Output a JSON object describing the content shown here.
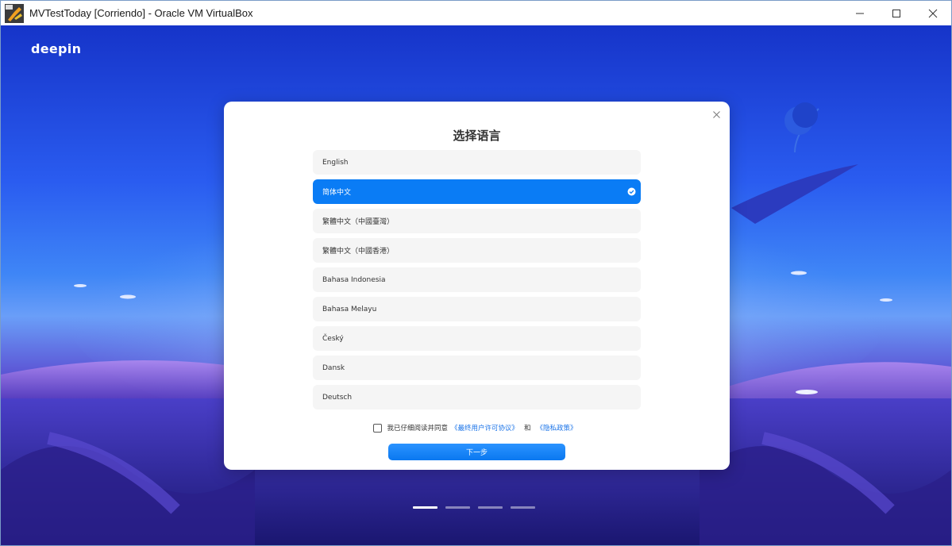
{
  "window": {
    "title": "MVTestToday [Corriendo] - Oracle VM VirtualBox",
    "app_icon": "virtualbox-icon",
    "controls": [
      "minimize-icon",
      "maximize-icon",
      "close-icon"
    ]
  },
  "desktop": {
    "logo": "deepin"
  },
  "dialog": {
    "title": "选择语言",
    "languages": [
      {
        "label": "English",
        "selected": false
      },
      {
        "label": "简体中文",
        "selected": true
      },
      {
        "label": "繁體中文（中國臺灣）",
        "selected": false
      },
      {
        "label": "繁體中文（中國香港）",
        "selected": false
      },
      {
        "label": "Bahasa Indonesia",
        "selected": false
      },
      {
        "label": "Bahasa Melayu",
        "selected": false
      },
      {
        "label": "Český",
        "selected": false
      },
      {
        "label": "Dansk",
        "selected": false
      },
      {
        "label": "Deutsch",
        "selected": false
      }
    ],
    "agree": {
      "text": "我已仔细阅读并同意",
      "eula_link": "《最终用户许可协议》",
      "and": "和",
      "privacy_link": "《隐私政策》",
      "checked": false
    },
    "next_button": "下一步"
  },
  "pager": {
    "total": 4,
    "current": 1
  },
  "colors": {
    "accent": "#0a7cf5",
    "link": "#1a73e8"
  }
}
